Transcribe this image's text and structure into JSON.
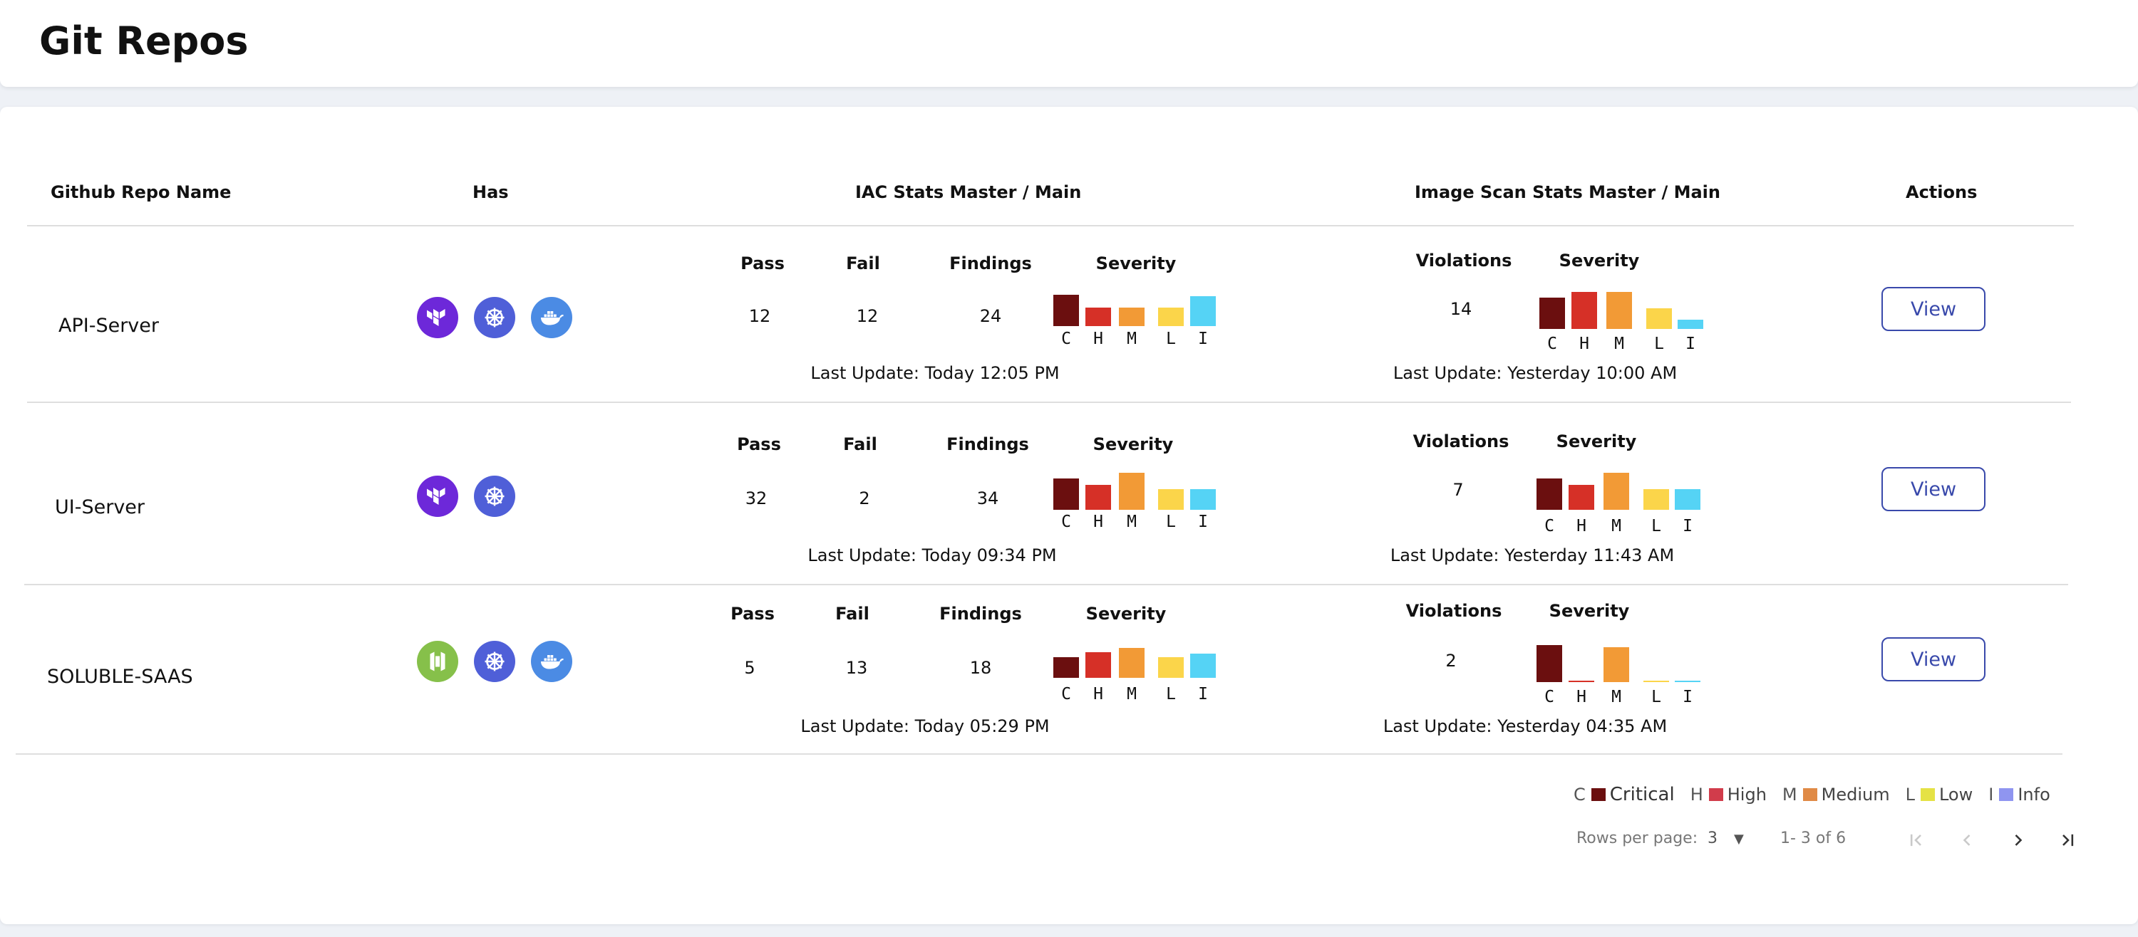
{
  "page": {
    "title": "Git Repos"
  },
  "table": {
    "headers": {
      "repo": "Github Repo Name",
      "has": "Has",
      "iac": "IAC Stats Master / Main",
      "image": "Image Scan Stats Master / Main",
      "actions": "Actions"
    },
    "labels": {
      "pass": "Pass",
      "fail": "Fail",
      "findings": "Findings",
      "severity": "Severity",
      "violations": "Violations",
      "sev_letters": [
        "C",
        "H",
        "M",
        "L",
        "I"
      ],
      "view": "View"
    },
    "rows": [
      {
        "name": "API-Server",
        "has": [
          "terraform-icon",
          "kubernetes-icon",
          "docker-icon"
        ],
        "iac": {
          "pass": "12",
          "fail": "12",
          "findings": "24",
          "severity": [
            0.85,
            0.5,
            0.5,
            0.5,
            0.8
          ],
          "last_update": "Last Update: Today 12:05 PM"
        },
        "image": {
          "violations": "14",
          "severity": [
            0.85,
            1.0,
            1.0,
            0.55,
            0.25
          ],
          "last_update": "Last Update: Yesterday 10:00 AM"
        }
      },
      {
        "name": "UI-Server",
        "has": [
          "terraform-icon",
          "kubernetes-icon"
        ],
        "iac": {
          "pass": "32",
          "fail": "2",
          "findings": "34",
          "severity": [
            0.85,
            0.68,
            1.0,
            0.55,
            0.55
          ],
          "last_update": "Last Update: Today 09:34 PM"
        },
        "image": {
          "violations": "7",
          "severity": [
            0.85,
            0.68,
            1.0,
            0.55,
            0.55
          ],
          "last_update": "Last Update: Yesterday 11:43 AM"
        }
      },
      {
        "name": "SOLUBLE-SAAS",
        "has": [
          "open-policy-agent-icon",
          "kubernetes-icon",
          "docker-icon"
        ],
        "iac": {
          "pass": "5",
          "fail": "13",
          "findings": "18",
          "severity": [
            0.55,
            0.7,
            0.8,
            0.55,
            0.65
          ],
          "last_update": "Last Update: Today 05:29 PM"
        },
        "image": {
          "violations": "2",
          "severity": [
            1.0,
            0.04,
            0.95,
            0.04,
            0.04
          ],
          "last_update": "Last Update: Yesterday 04:35 AM"
        }
      }
    ]
  },
  "severity_colors": [
    "#6b0f0f",
    "#d63027",
    "#f29a36",
    "#fbd54a",
    "#55d3f5"
  ],
  "legend": [
    {
      "letter": "C",
      "label": "Critical",
      "color": "#6b0f0f"
    },
    {
      "letter": "H",
      "label": "High",
      "color": "#d13c4b"
    },
    {
      "letter": "M",
      "label": "Medium",
      "color": "#e08a46"
    },
    {
      "letter": "L",
      "label": "Low",
      "color": "#e5e245"
    },
    {
      "letter": "I",
      "label": "Info",
      "color": "#8f95f0"
    }
  ],
  "pagination": {
    "rows_label": "Rows per page:",
    "rows_value": "3",
    "range": "1- 3  of  6"
  }
}
